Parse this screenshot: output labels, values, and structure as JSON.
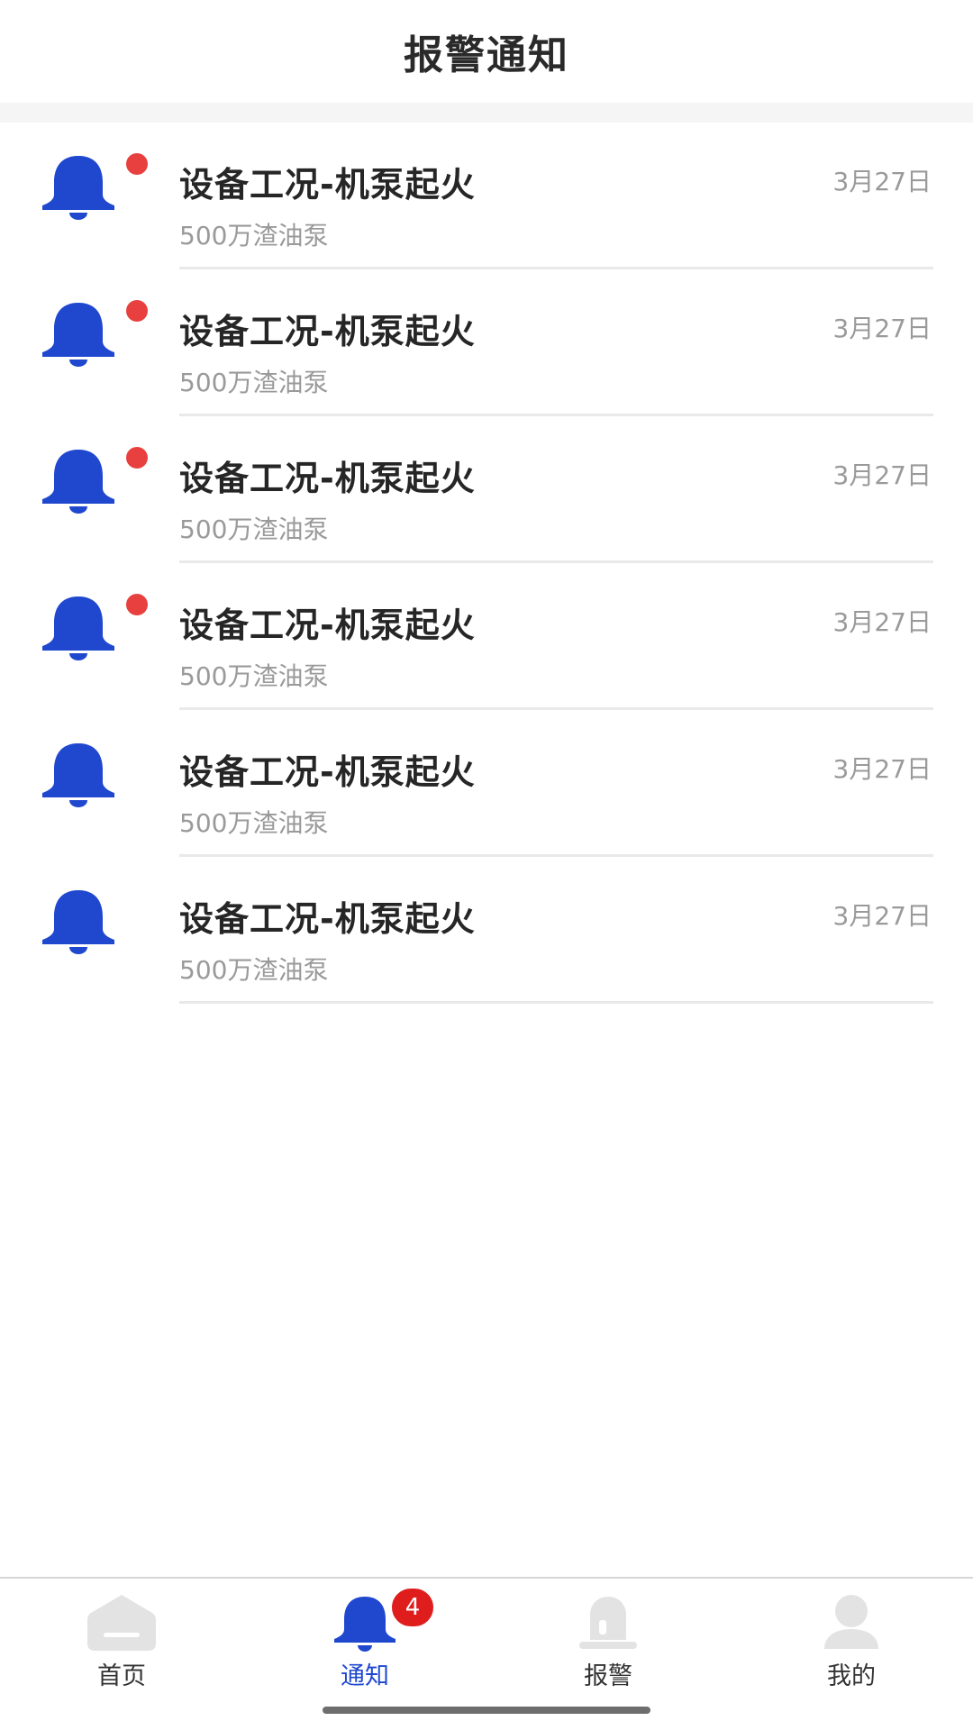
{
  "header": {
    "title": "报警通知"
  },
  "notifications": [
    {
      "title": "设备工况-机泵起火",
      "subtitle": "500万渣油泵",
      "date": "3月27日",
      "unread": true
    },
    {
      "title": "设备工况-机泵起火",
      "subtitle": "500万渣油泵",
      "date": "3月27日",
      "unread": true
    },
    {
      "title": "设备工况-机泵起火",
      "subtitle": "500万渣油泵",
      "date": "3月27日",
      "unread": true
    },
    {
      "title": "设备工况-机泵起火",
      "subtitle": "500万渣油泵",
      "date": "3月27日",
      "unread": true
    },
    {
      "title": "设备工况-机泵起火",
      "subtitle": "500万渣油泵",
      "date": "3月27日",
      "unread": false
    },
    {
      "title": "设备工况-机泵起火",
      "subtitle": "500万渣油泵",
      "date": "3月27日",
      "unread": false
    }
  ],
  "tabbar": {
    "active": "notify",
    "tabs": [
      {
        "id": "home",
        "label": "首页",
        "icon": "home-icon"
      },
      {
        "id": "notify",
        "label": "通知",
        "icon": "bell-icon",
        "badge": "4"
      },
      {
        "id": "alarm",
        "label": "报警",
        "icon": "siren-icon"
      },
      {
        "id": "mine",
        "label": "我的",
        "icon": "user-icon"
      }
    ]
  },
  "colors": {
    "accent": "#1f48cf",
    "unread_dot": "#e8403f",
    "badge": "#e01d1d",
    "inactive_icon": "#e3e3e3"
  }
}
